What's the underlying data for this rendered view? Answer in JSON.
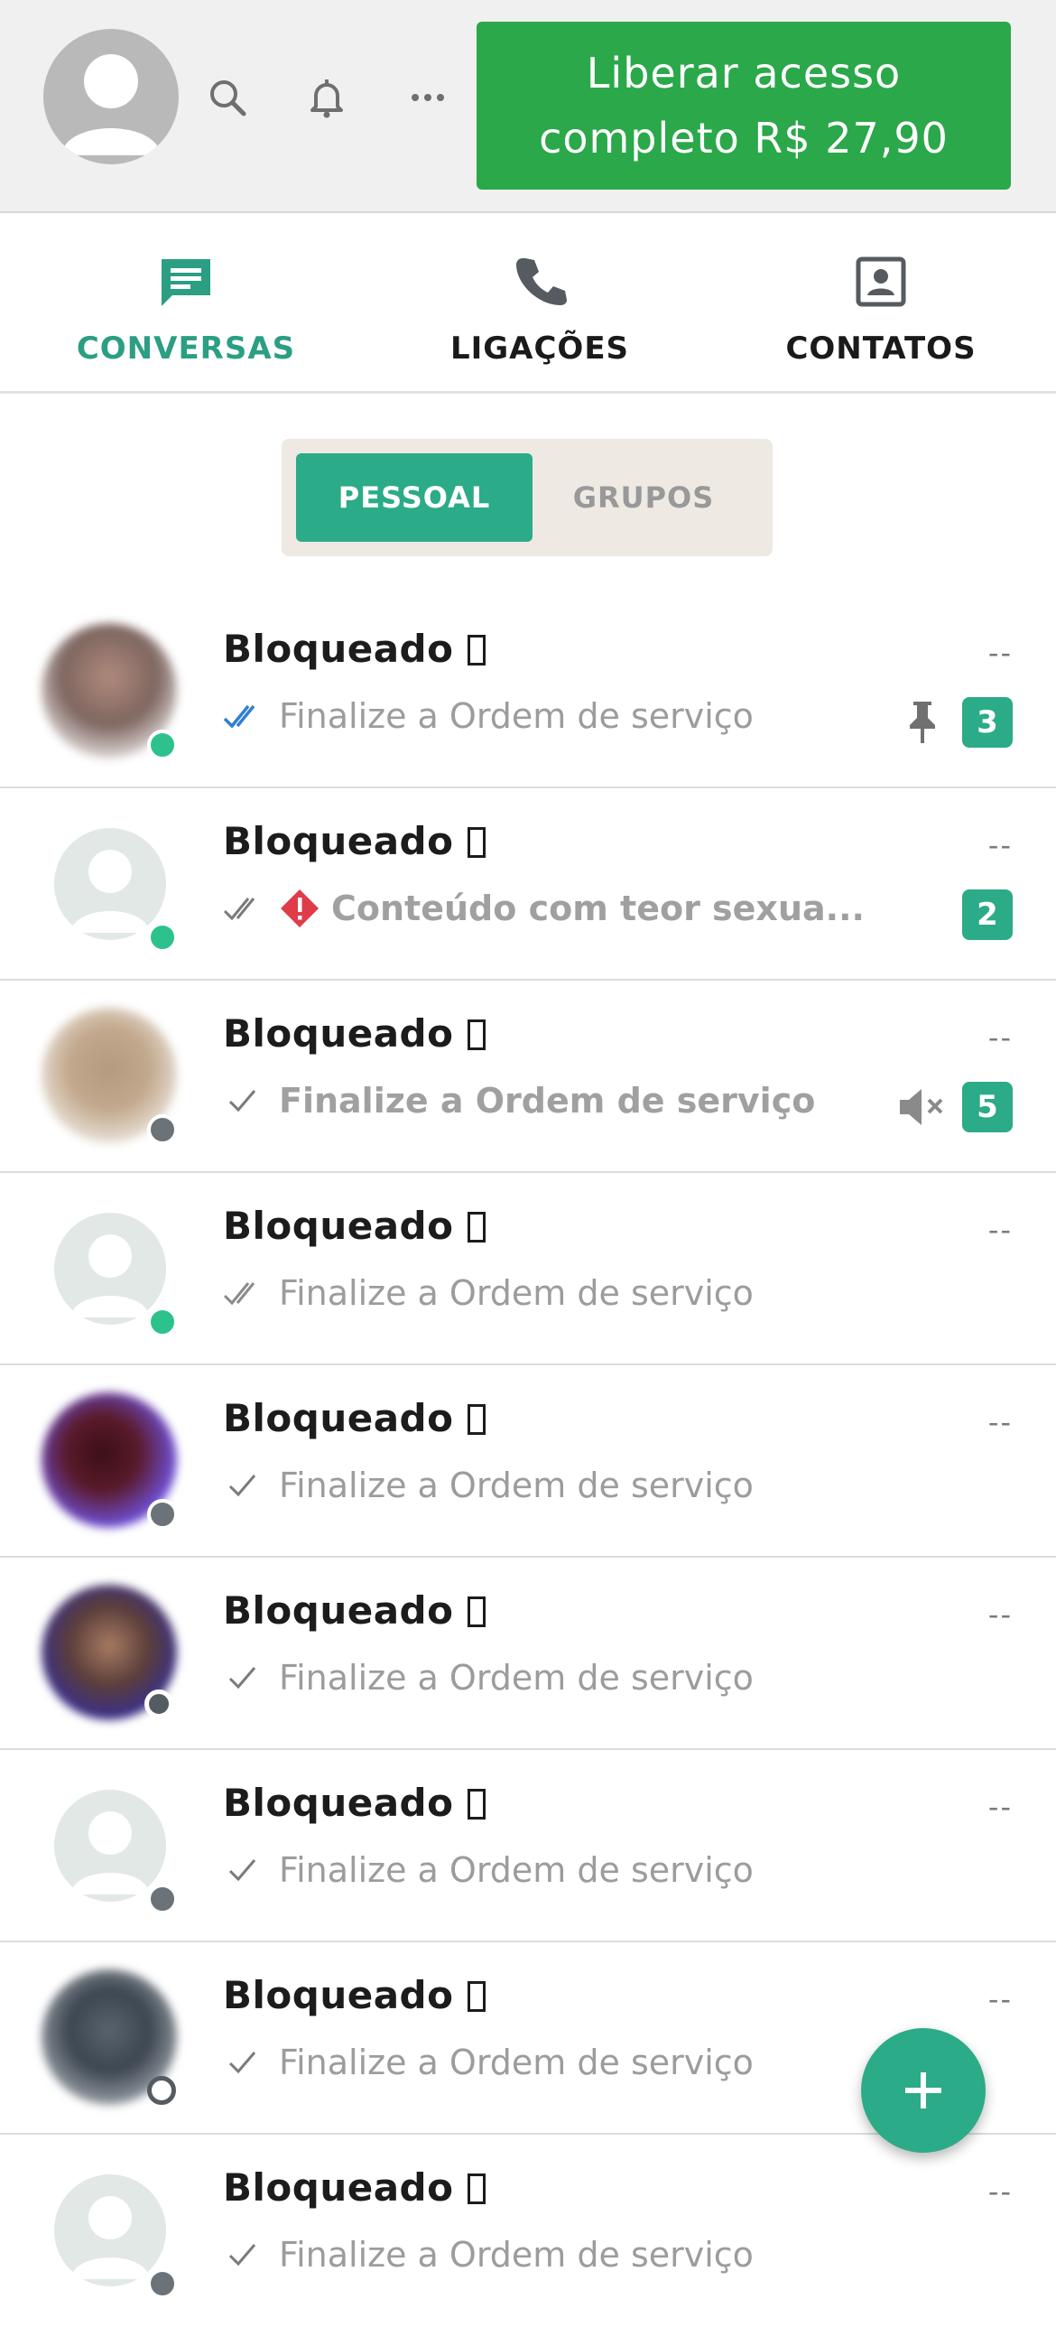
{
  "header": {
    "cta_label": "Liberar acesso completo R$ 27,90",
    "icons": [
      "avatar",
      "search-icon",
      "bell-icon",
      "more-icon"
    ]
  },
  "tabs": [
    {
      "label": "CONVERSAS",
      "icon": "chat-icon",
      "active": true
    },
    {
      "label": "LIGAÇÕES",
      "icon": "phone-icon",
      "active": false
    },
    {
      "label": "CONTATOS",
      "icon": "contacts-icon",
      "active": false
    }
  ],
  "segment": {
    "pessoal": "PESSOAL",
    "grupos": "GRUPOS",
    "selected": "PESSOAL"
  },
  "chats": [
    {
      "name": "Bloqueado",
      "time": "--",
      "preview": "Finalize a Ordem de serviço",
      "status": "read",
      "unread": "3",
      "pinned": true,
      "muted": false,
      "online": "green",
      "avatar": "photo",
      "bold": false,
      "warning": false
    },
    {
      "name": "Bloqueado",
      "time": "--",
      "preview": "Conteúdo com teor sexua...",
      "status": "delivered",
      "unread": "2",
      "pinned": false,
      "muted": false,
      "online": "green",
      "avatar": "default",
      "bold": true,
      "warning": true
    },
    {
      "name": "Bloqueado",
      "time": "--",
      "preview": "Finalize a Ordem de serviço",
      "status": "sent",
      "unread": "5",
      "pinned": false,
      "muted": true,
      "online": "gray",
      "avatar": "photo",
      "bold": true,
      "warning": false
    },
    {
      "name": "Bloqueado",
      "time": "--",
      "preview": "Finalize a Ordem de serviço",
      "status": "delivered",
      "unread": "",
      "pinned": false,
      "muted": false,
      "online": "green",
      "avatar": "default",
      "bold": false,
      "warning": false
    },
    {
      "name": "Bloqueado",
      "time": "--",
      "preview": "Finalize a Ordem de serviço",
      "status": "sent",
      "unread": "",
      "pinned": false,
      "muted": false,
      "online": "gray",
      "avatar": "photo",
      "bold": false,
      "warning": false
    },
    {
      "name": "Bloqueado",
      "time": "--",
      "preview": "Finalize a Ordem de serviço",
      "status": "sent",
      "unread": "",
      "pinned": false,
      "muted": false,
      "online": "gray",
      "avatar": "photo",
      "bold": false,
      "warning": false
    },
    {
      "name": "Bloqueado",
      "time": "--",
      "preview": "Finalize a Ordem de serviço",
      "status": "sent",
      "unread": "",
      "pinned": false,
      "muted": false,
      "online": "gray",
      "avatar": "default",
      "bold": false,
      "warning": false
    },
    {
      "name": "Bloqueado",
      "time": "--",
      "preview": "Finalize a Ordem de serviço",
      "status": "sent",
      "unread": "",
      "pinned": false,
      "muted": false,
      "online": "ring",
      "avatar": "photo",
      "bold": false,
      "warning": false
    },
    {
      "name": "Bloqueado",
      "time": "--",
      "preview": "Finalize a Ordem de serviço",
      "status": "sent",
      "unread": "",
      "pinned": false,
      "muted": false,
      "online": "gray",
      "avatar": "default",
      "bold": false,
      "warning": false
    }
  ],
  "fab": {
    "icon": "plus-icon"
  },
  "colors": {
    "accent": "#2bab87",
    "cta": "#2ba84a",
    "online": "#2dc28c",
    "offline": "#6c7378",
    "read_check": "#2f7fd1",
    "warning": "#e03b48"
  }
}
